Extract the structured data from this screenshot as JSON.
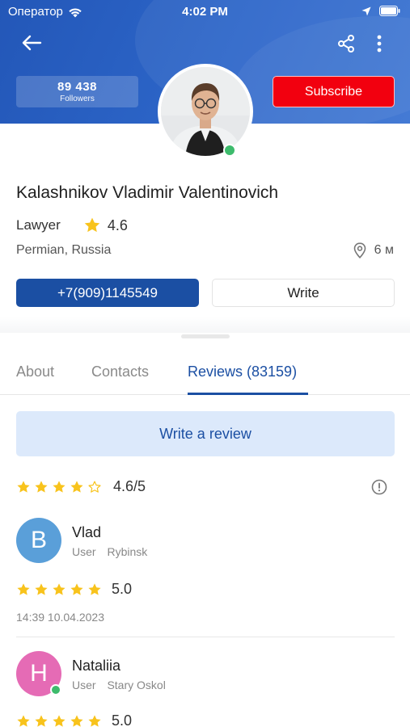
{
  "status_bar": {
    "carrier": "Оператор",
    "time": "4:02 PM"
  },
  "profile": {
    "followers_count": "89 438",
    "followers_label": "Followers",
    "subscribe_label": "Subscribe",
    "name": "Kalashnikov Vladimir Valentinovich",
    "profession": "Lawyer",
    "rating": "4.6",
    "location": "Permian, Russia",
    "distance": "6 м",
    "phone": "+7(909)1145549",
    "write_label": "Write",
    "online": true
  },
  "tabs": [
    {
      "label": "About",
      "active": false
    },
    {
      "label": "Contacts",
      "active": false
    },
    {
      "label": "Reviews (83159)",
      "active": true
    }
  ],
  "reviews_section": {
    "write_review_label": "Write a review",
    "summary_value": "4.6/5",
    "summary_stars": 4,
    "items": [
      {
        "initial": "B",
        "name": "Vlad",
        "role": "User",
        "city": "Rybinsk",
        "rating": "5.0",
        "stars": 5,
        "date": "14:39 10.04.2023",
        "avatar_color": "#5a9fd9",
        "online": false
      },
      {
        "initial": "H",
        "name": "Nataliia",
        "role": "User",
        "city": "Stary Oskol",
        "rating": "5.0",
        "stars": 5,
        "date": "",
        "avatar_color": "#e56bb5",
        "online": true
      }
    ]
  },
  "colors": {
    "header_blue": "#2357b8",
    "primary": "#1b4fa3",
    "subscribe_red": "#f2000f",
    "star_yellow": "#f8c31c",
    "online_green": "#3dbb6c"
  },
  "icons": [
    "back-arrow-icon",
    "share-icon",
    "more-vertical-icon",
    "star-icon",
    "location-pin-icon",
    "info-icon",
    "wifi-icon",
    "location-arrow-icon",
    "battery-icon"
  ]
}
